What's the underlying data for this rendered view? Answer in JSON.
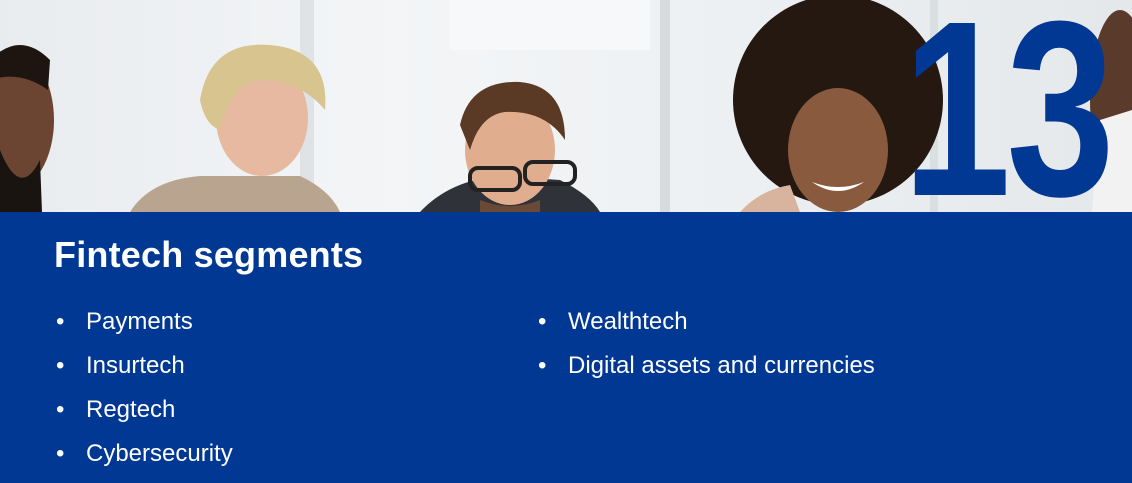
{
  "badge": {
    "number": "13"
  },
  "section": {
    "title": "Fintech segments",
    "left_items": [
      "Payments",
      "Insurtech",
      "Regtech",
      "Cybersecurity"
    ],
    "right_items": [
      "Wealthtech",
      "Digital assets and currencies"
    ],
    "bullet": "•"
  },
  "colors": {
    "brand_blue": "#003893",
    "text": "#ffffff"
  },
  "photo": {
    "description_icon": "team-meeting-photo"
  }
}
